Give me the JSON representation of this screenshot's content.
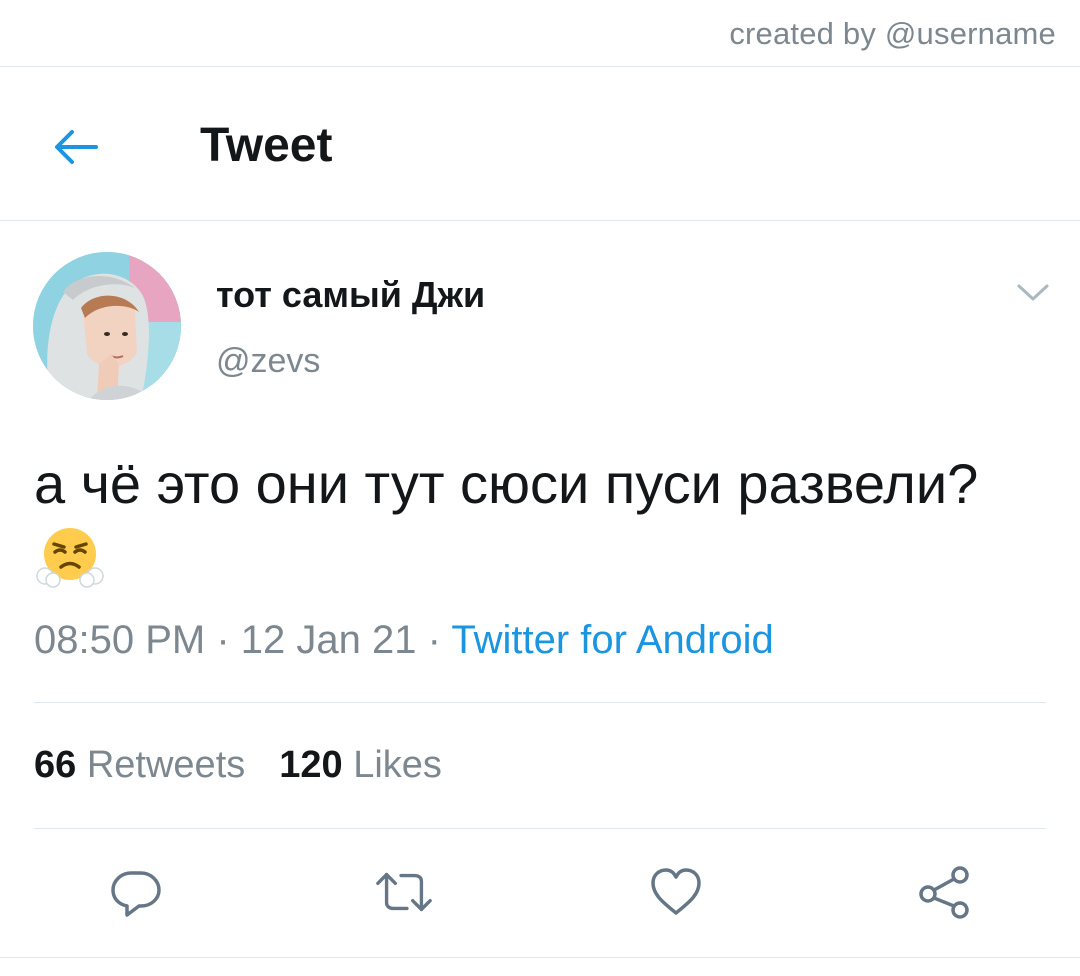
{
  "credit": "created by @username",
  "header": {
    "back_icon": "back-arrow-icon",
    "title": "Tweet"
  },
  "tweet": {
    "author": {
      "display_name": "тот самый Джи",
      "handle": "@zevs"
    },
    "text": "а чё это они тут сюси пуси развели?",
    "emoji": "face-with-steam-from-nose",
    "time": "08:50 PM",
    "separator": "·",
    "date": "12 Jan 21",
    "source": "Twitter for Android",
    "stats": {
      "retweets_count": "66",
      "retweets_label": "Retweets",
      "likes_count": "120",
      "likes_label": "Likes"
    },
    "actions": [
      "reply-icon",
      "retweet-icon",
      "like-icon",
      "share-icon"
    ]
  },
  "colors": {
    "accent": "#1b95e0",
    "text_primary": "#14171a",
    "text_secondary": "#7d8790",
    "divider": "#e1e8ed"
  }
}
